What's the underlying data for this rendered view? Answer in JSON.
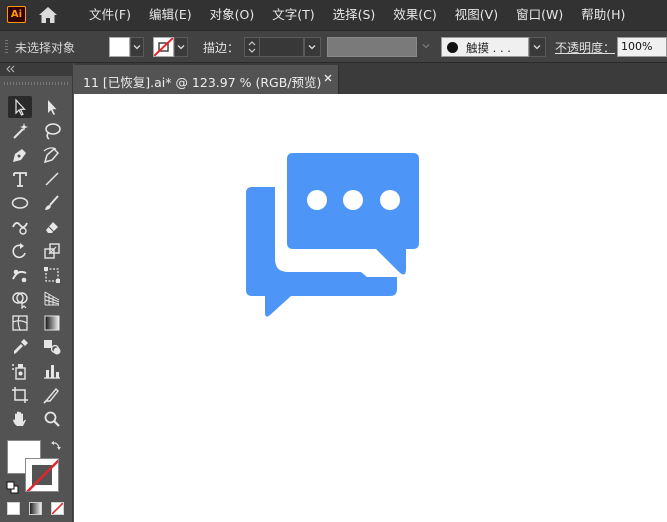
{
  "app": {
    "logo": "Ai"
  },
  "menu": {
    "items": [
      "文件(F)",
      "编辑(E)",
      "对象(O)",
      "文字(T)",
      "选择(S)",
      "效果(C)",
      "视图(V)",
      "窗口(W)",
      "帮助(H)"
    ]
  },
  "control_bar": {
    "no_selection": "未选择对象",
    "stroke_label": "描边：",
    "stroke_weight": "",
    "brush": "触摸 . . .",
    "opacity_label": "不透明度：",
    "opacity_value": "100%"
  },
  "document": {
    "tab_title": "11 [已恢复].ai* @ 123.97 % (RGB/预览)"
  },
  "colors": {
    "ui_dark": "#323232",
    "panel": "#535353",
    "canvas": "#ffffff",
    "artwork": "#4d96f7"
  },
  "tools": [
    "selection-tool",
    "direct-selection-tool",
    "magic-wand-tool",
    "lasso-tool",
    "pen-tool",
    "curvature-tool",
    "type-tool",
    "line-segment-tool",
    "ellipse-tool",
    "paintbrush-tool",
    "shaper-tool",
    "eraser-tool",
    "rotate-tool",
    "scale-tool",
    "puppet-warp-tool",
    "free-transform-tool",
    "shape-builder-tool",
    "perspective-grid-tool",
    "mesh-tool",
    "gradient-tool",
    "eyedropper-tool",
    "blend-tool",
    "symbol-sprayer-tool",
    "column-graph-tool",
    "artboard-tool",
    "slice-tool",
    "hand-tool",
    "zoom-tool"
  ]
}
